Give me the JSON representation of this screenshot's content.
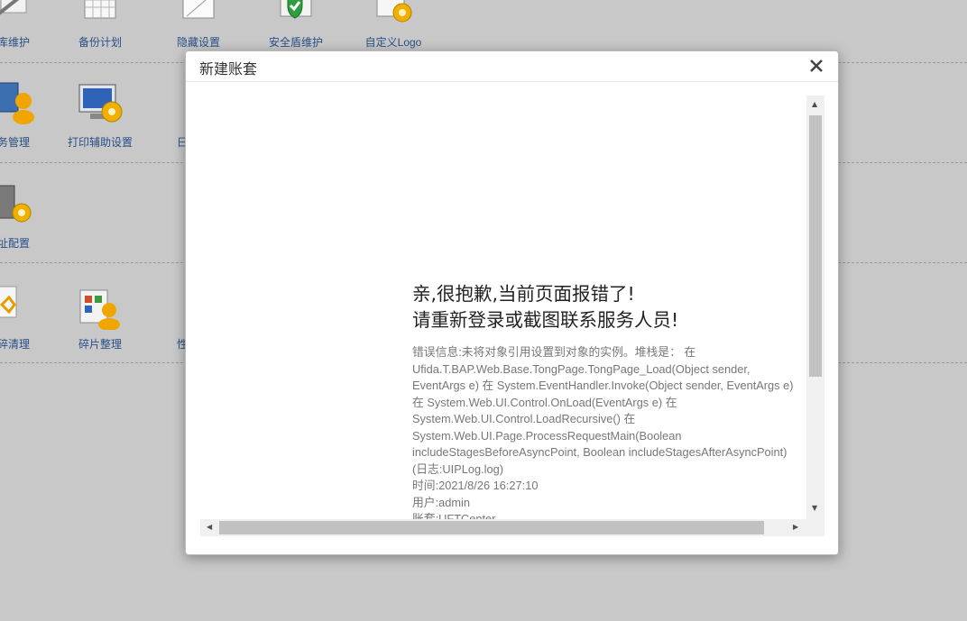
{
  "background": {
    "row1": [
      "库维护",
      "备份计划",
      "隐藏设置",
      "安全盾维护",
      "自定义Logo"
    ],
    "row2": [
      "务管理",
      "打印辅助设置",
      "日"
    ],
    "row3": [
      "址配置"
    ],
    "row4": [
      "碎清理",
      "碎片整理",
      "性"
    ]
  },
  "modal": {
    "title": "新建账套",
    "close_icon": "close-icon",
    "error": {
      "title_line1": "亲,很抱歉,当前页面报错了!",
      "title_line2": "请重新登录或截图联系服务人员!",
      "info_lines": [
        "错误信息:未将对象引用设置到对象的实例。堆栈是：  在",
        "Ufida.T.BAP.Web.Base.TongPage.TongPage_Load(Object sender,",
        "EventArgs e) 在 System.EventHandler.Invoke(Object sender, EventArgs e)",
        "在 System.Web.UI.Control.OnLoad(EventArgs e) 在",
        "System.Web.UI.Control.LoadRecursive() 在",
        "System.Web.UI.Page.ProcessRequestMain(Boolean",
        "includeStagesBeforeAsyncPoint, Boolean includeStagesAfterAsyncPoint)",
        "(日志:UIPLog.log)",
        "时间:2021/8/26 16:27:10",
        "用户:admin",
        "账套:UFTCenter"
      ]
    }
  }
}
